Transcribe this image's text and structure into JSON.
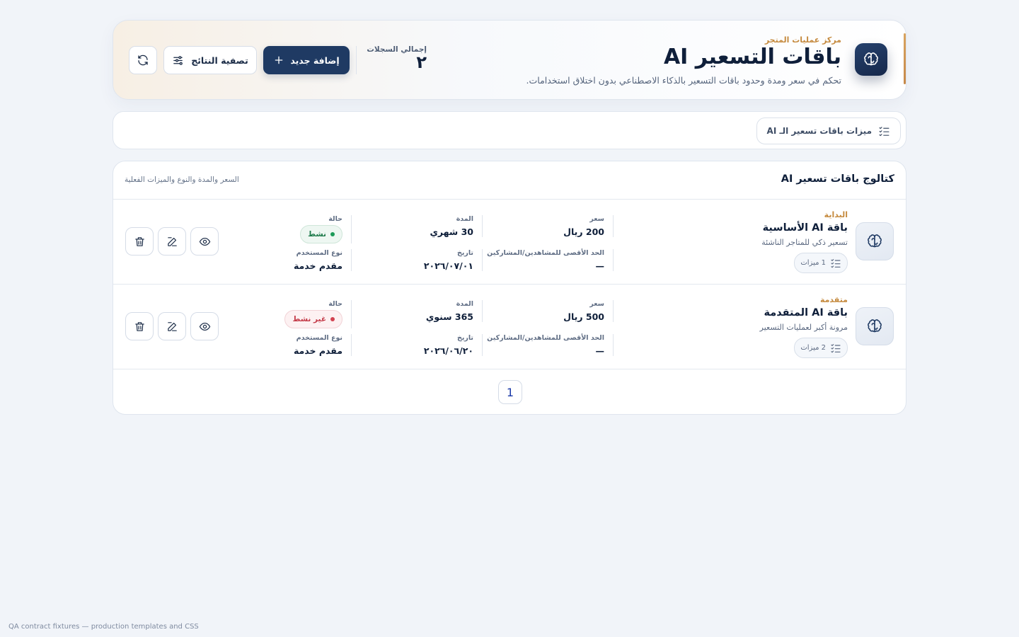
{
  "header": {
    "eyebrow": "مركز عمليات المتجر",
    "title": "باقات التسعير AI",
    "subtitle": "تحكم في سعر ومدة وحدود باقات التسعير بالذكاء الاصطناعي بدون اختلاق استخدامات.",
    "stat_label": "إجمالي السجلات",
    "stat_value": "٢",
    "add_label": "إضافة جديد",
    "filter_label": "تصفية النتائج",
    "icon": "brain-icon"
  },
  "tabs": [
    {
      "label": "ميزات باقات تسعير الـ AI",
      "icon": "checklist-icon"
    }
  ],
  "catalog": {
    "title": "كتالوج باقات تسعير AI",
    "subtitle": "السعر والمدة والنوع والميزات الفعلية",
    "labels": {
      "price": "سعر",
      "duration": "المدة",
      "status": "حالة",
      "limit": "الحد الأقصى للمشاهدين/المشاركين",
      "date": "تاريخ",
      "user_type": "نوع المستخدم"
    },
    "rows": [
      {
        "tier": "البداية",
        "name": "باقة AI الأساسية",
        "description": "تسعير ذكي للمتاجر الناشئة",
        "features": "1 ميزات",
        "price": "200 ريال",
        "duration": "30 شهري",
        "status": "نشط",
        "limit": "—",
        "date": "٢٠٢٦/٠٧/٠١",
        "user_type": "مقدم خدمة"
      },
      {
        "tier": "متقدمة",
        "name": "باقة AI المتقدمة",
        "description": "مرونة أكبر لعمليات التسعير",
        "features": "2 ميزات",
        "price": "500 ريال",
        "duration": "365 سنوي",
        "status": "غير نشط",
        "limit": "—",
        "date": "٢٠٢٦/٠٦/٢٠",
        "user_type": "مقدم خدمة"
      }
    ],
    "page": "1"
  },
  "footnote": "QA contract fixtures — production templates and CSS",
  "colors": {
    "primary": "#1f3a63",
    "accent": "#c58a3e",
    "active": "#1d7a4a",
    "inactive": "#c43a48"
  }
}
